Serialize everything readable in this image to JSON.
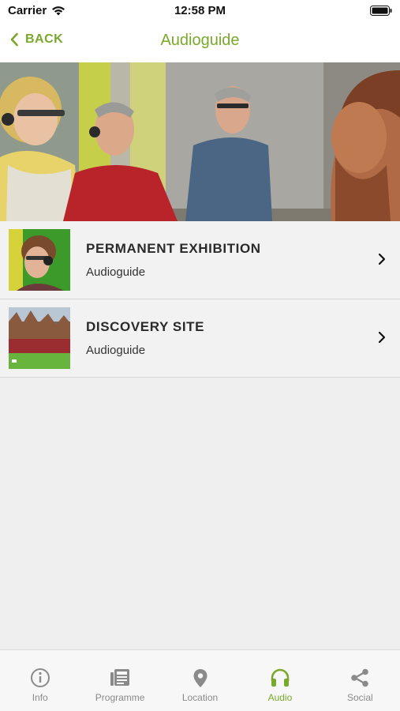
{
  "status": {
    "carrier": "Carrier",
    "time": "12:58 PM"
  },
  "nav": {
    "back_label": "BACK",
    "title": "Audioguide"
  },
  "items": [
    {
      "title": "PERMANENT EXHIBITION",
      "subtitle": "Audioguide",
      "thumb_icon": "exhibition-thumbnail"
    },
    {
      "title": "DISCOVERY SITE",
      "subtitle": "Audioguide",
      "thumb_icon": "discovery-site-thumbnail"
    }
  ],
  "tabs": [
    {
      "label": "Info",
      "icon": "info-icon",
      "active": false
    },
    {
      "label": "Programme",
      "icon": "newspaper-icon",
      "active": false
    },
    {
      "label": "Location",
      "icon": "location-pin-icon",
      "active": false
    },
    {
      "label": "Audio",
      "icon": "headphones-icon",
      "active": true
    },
    {
      "label": "Social",
      "icon": "share-icon",
      "active": false
    }
  ],
  "colors": {
    "accent": "#7aa82c",
    "inactive": "#8a8a8a",
    "background": "#efefef"
  }
}
